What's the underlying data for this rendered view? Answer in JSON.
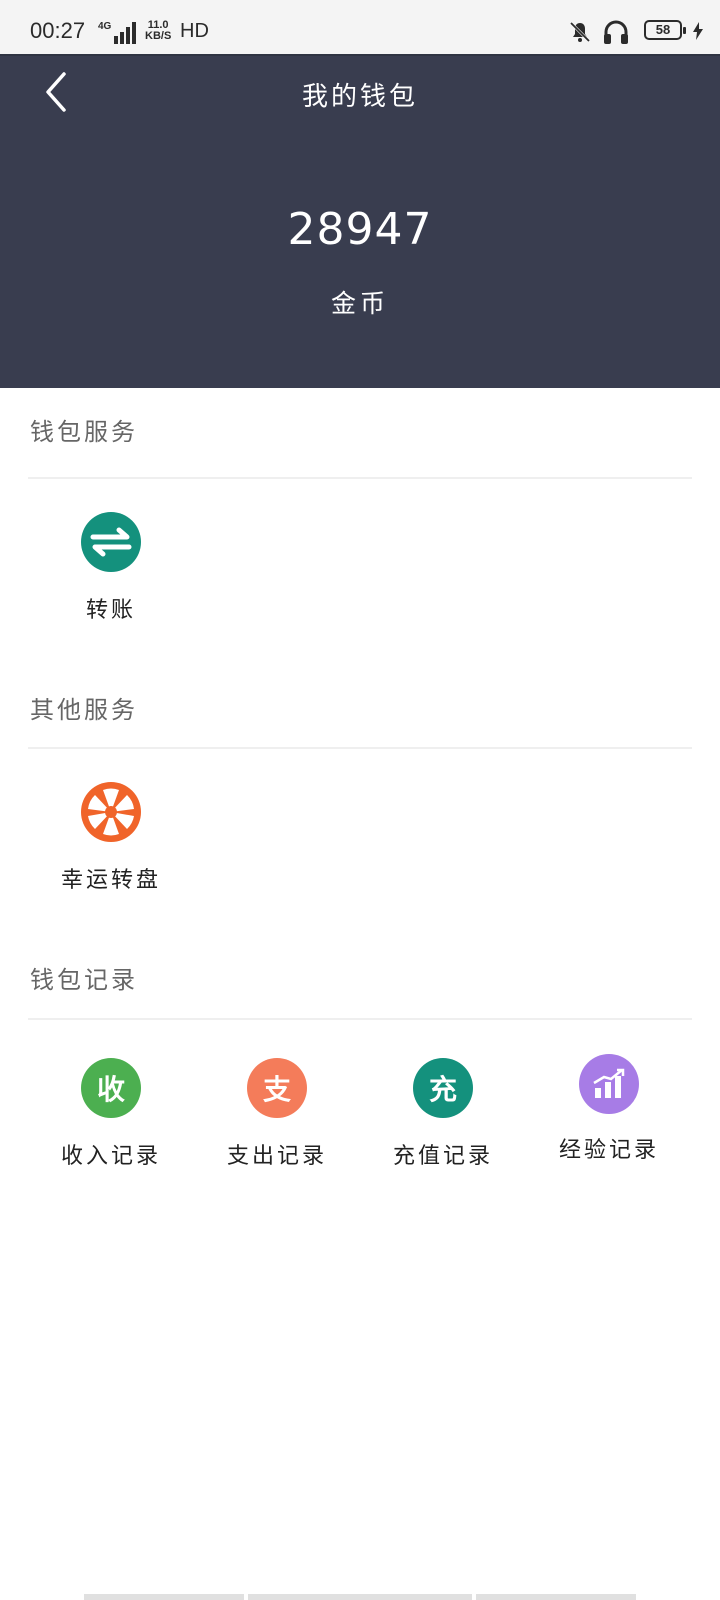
{
  "status_bar": {
    "time": "00:27",
    "network": "4G",
    "speed_value": "11.0",
    "speed_unit": "KB/S",
    "hd": "HD",
    "battery": "58"
  },
  "header": {
    "title": "我的钱包",
    "balance": "28947",
    "unit": "金币"
  },
  "sections": {
    "wallet_services": {
      "title": "钱包服务",
      "items": [
        {
          "label": "转账",
          "icon": "transfer-icon",
          "color": "#14917d"
        }
      ]
    },
    "other_services": {
      "title": "其他服务",
      "items": [
        {
          "label": "幸运转盘",
          "icon": "lucky-wheel-icon",
          "color": "#f0642a"
        }
      ]
    },
    "wallet_records": {
      "title": "钱包记录",
      "items": [
        {
          "label": "收入记录",
          "icon_text": "收",
          "icon": "income-icon",
          "color": "#4caf50"
        },
        {
          "label": "支出记录",
          "icon_text": "支",
          "icon": "expense-icon",
          "color": "#f47c5a"
        },
        {
          "label": "充值记录",
          "icon_text": "充",
          "icon": "recharge-icon",
          "color": "#14917d"
        },
        {
          "label": "经验记录",
          "icon": "experience-chart-icon",
          "color": "#a77ce6"
        }
      ]
    }
  },
  "colors": {
    "header_bg": "#393d4f",
    "accent_teal": "#14917d"
  }
}
